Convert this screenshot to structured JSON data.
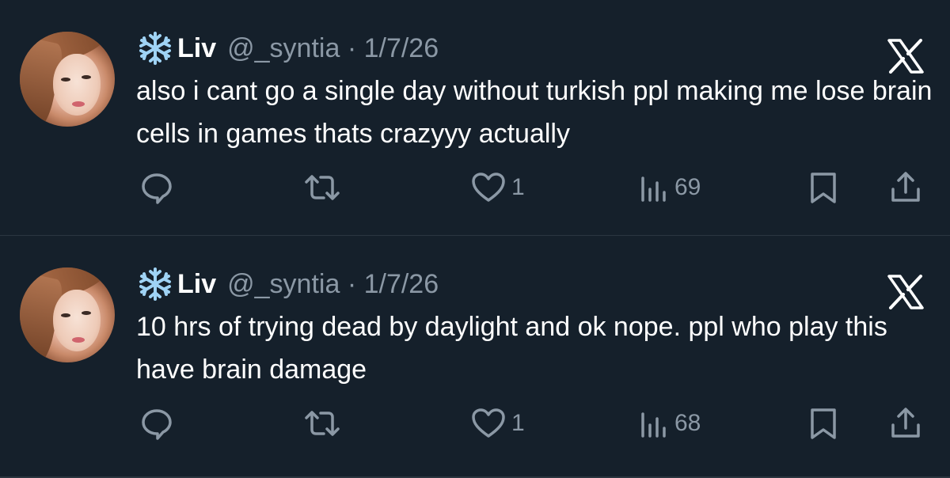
{
  "colors": {
    "background": "#15202b",
    "text": "#ffffff",
    "secondary": "#8b98a5",
    "divider": "#2b3640"
  },
  "tweets": [
    {
      "name_emoji_icon": "snowflake-icon",
      "name": "Liv",
      "handle_date": "@_syntia · 1/7/26",
      "text": "also i cant go a single day without turkish ppl making me lose brain cells in games thats crazyyy actually",
      "likes": "1",
      "views": "69"
    },
    {
      "name_emoji_icon": "snowflake-icon",
      "name": "Liv",
      "handle_date": "@_syntia · 1/7/26",
      "text": "10 hrs of trying dead by daylight and ok nope. ppl who play this have brain damage",
      "likes": "1",
      "views": "68"
    }
  ]
}
